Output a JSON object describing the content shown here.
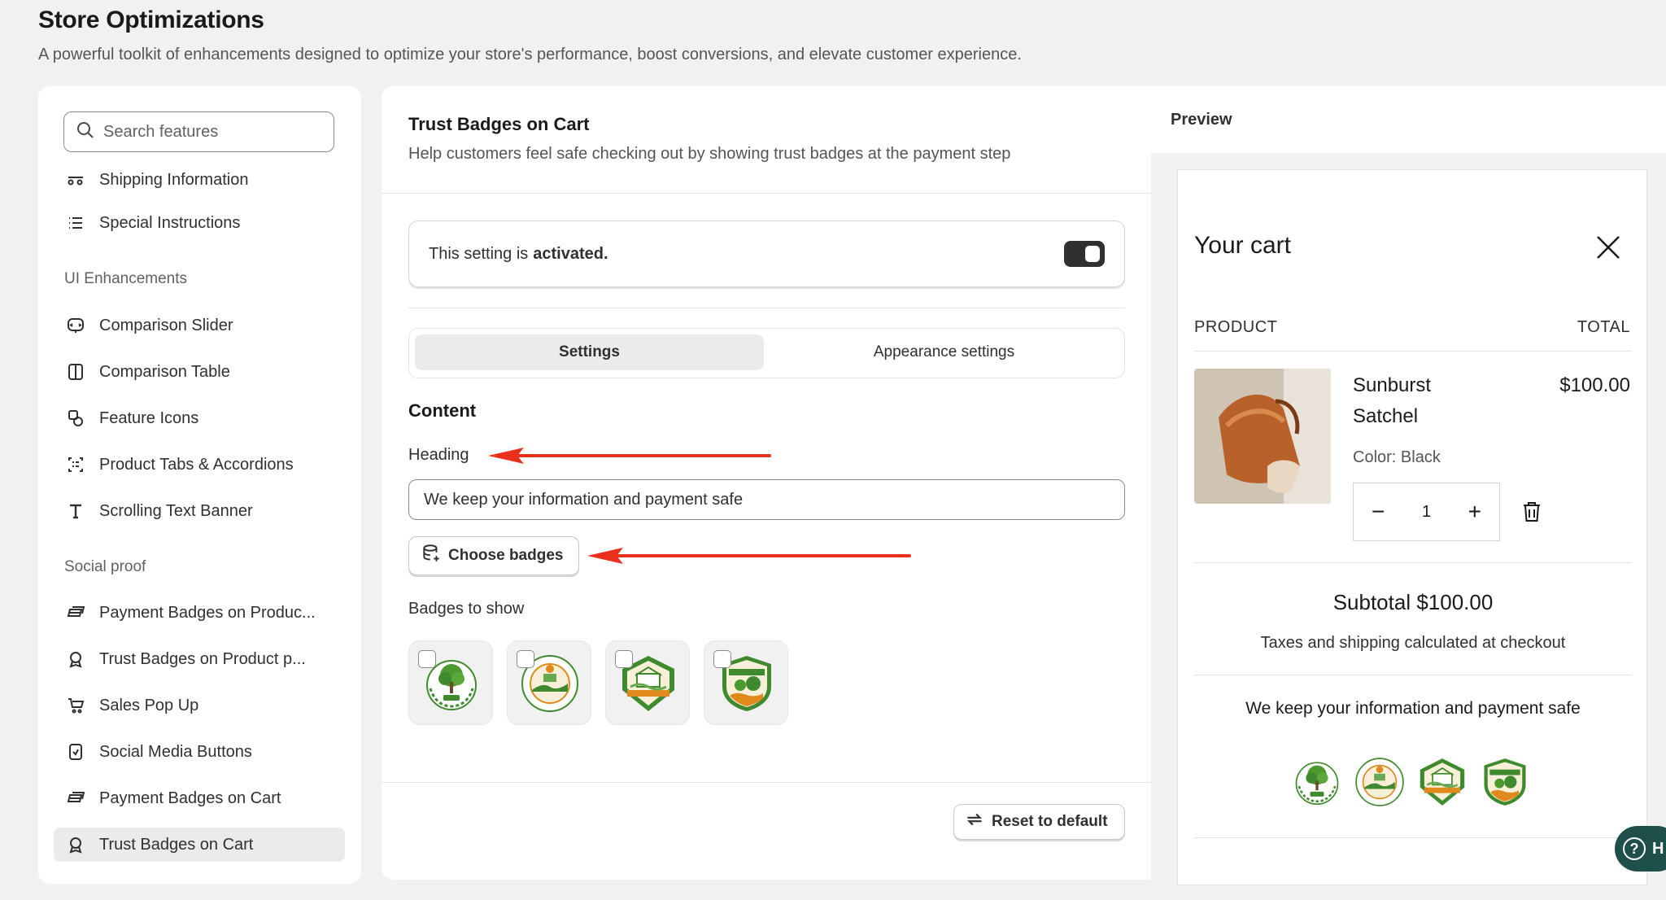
{
  "page": {
    "title": "Store Optimizations",
    "subtitle": "A powerful toolkit of enhancements designed to optimize your store's performance, boost conversions, and elevate customer experience."
  },
  "sidebar": {
    "search_placeholder": "Search features",
    "top_items": [
      {
        "label": "Shipping Information",
        "icon": "truck-icon"
      },
      {
        "label": "Special Instructions",
        "icon": "list-icon"
      }
    ],
    "groups": [
      {
        "label": "UI Enhancements",
        "items": [
          {
            "label": "Comparison Slider",
            "icon": "slider-icon"
          },
          {
            "label": "Comparison Table",
            "icon": "columns-icon"
          },
          {
            "label": "Feature Icons",
            "icon": "shapes-icon"
          },
          {
            "label": "Product Tabs & Accordions",
            "icon": "tabs-icon"
          },
          {
            "label": "Scrolling Text Banner",
            "icon": "text-icon"
          }
        ]
      },
      {
        "label": "Social proof",
        "items": [
          {
            "label": "Payment Badges on Produc...",
            "icon": "payment-icon"
          },
          {
            "label": "Trust Badges on Product p...",
            "icon": "badge-icon"
          },
          {
            "label": "Sales Pop Up",
            "icon": "popup-icon"
          },
          {
            "label": "Social Media Buttons",
            "icon": "social-icon"
          },
          {
            "label": "Payment Badges on Cart",
            "icon": "payment-icon"
          },
          {
            "label": "Trust Badges on Cart",
            "icon": "badge-icon",
            "active": true
          }
        ]
      }
    ]
  },
  "main": {
    "title": "Trust Badges on Cart",
    "description": "Help customers feel safe checking out by showing trust badges at the payment step",
    "status_prefix": "This setting is",
    "status_value": "activated.",
    "toggle_on": true,
    "tabs": [
      {
        "label": "Settings",
        "selected": true
      },
      {
        "label": "Appearance settings",
        "selected": false
      }
    ],
    "content_heading": "Content",
    "heading_label": "Heading",
    "heading_value": "We keep your information and payment safe",
    "choose_badges_label": "Choose badges",
    "badges_label": "Badges to show",
    "badges": [
      {
        "name": "eco-badge"
      },
      {
        "name": "natural-products-badge"
      },
      {
        "name": "bio-products-badge"
      },
      {
        "name": "natural-products-shield-badge"
      }
    ],
    "reset_label": "Reset to default"
  },
  "preview": {
    "label": "Preview",
    "cart_title": "Your cart",
    "col_product": "PRODUCT",
    "col_total": "TOTAL",
    "product": {
      "name": "Sunburst Satchel",
      "price": "$100.00",
      "color": "Color: Black",
      "quantity": "1"
    },
    "subtotal": "Subtotal $100.00",
    "taxes": "Taxes and shipping calculated at checkout",
    "safe_heading": "We keep your information and payment safe"
  },
  "help": {
    "label": "H"
  },
  "colors": {
    "accent_dark": "#303030",
    "arrow": "#e8301c",
    "badge_green": "#3f8a2e",
    "badge_orange": "#e08a1e",
    "help_bg": "#1f4f4b"
  }
}
